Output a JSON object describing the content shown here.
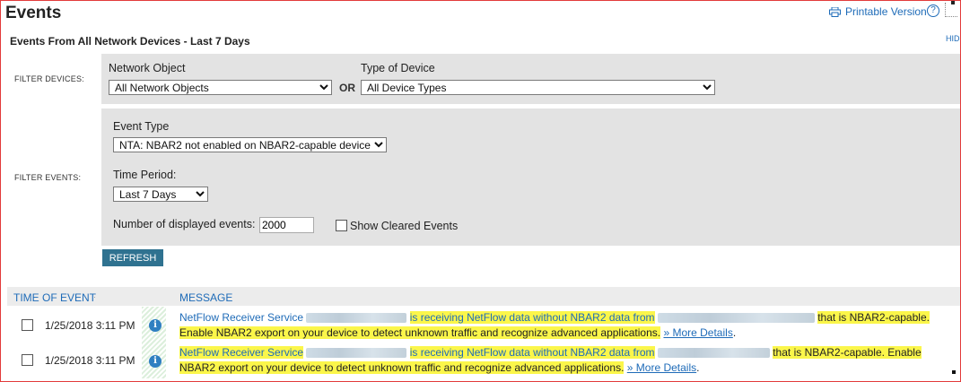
{
  "header": {
    "title": "Events",
    "printable_label": "Printable Version",
    "help_icon": "question-circle-icon",
    "hide_label": "HID",
    "subtitle": "Events From All Network Devices - Last 7 Days"
  },
  "filter_devices": {
    "label": "FILTER DEVICES:",
    "network_object_label": "Network Object",
    "network_object_value": "All Network Objects",
    "or_label": "OR",
    "device_type_label": "Type of Device",
    "device_type_value": "All Device Types"
  },
  "filter_events": {
    "label": "FILTER EVENTS:",
    "event_type_label": "Event Type",
    "event_type_value": "NTA: NBAR2 not enabled on NBAR2-capable device",
    "time_period_label": "Time Period:",
    "time_period_value": "Last 7 Days",
    "num_events_label": "Number of displayed events:",
    "num_events_value": "2000",
    "show_cleared_label": "Show Cleared Events",
    "refresh_label": "REFRESH"
  },
  "table": {
    "col_time": "TIME OF EVENT",
    "sort_glyph": "·",
    "col_message": "MESSAGE",
    "rows": [
      {
        "time": "1/25/2018 3:11 PM",
        "service": "NetFlow Receiver Service",
        "mid": "is receiving NetFlow data without NBAR2 data from",
        "tail": "that is NBAR2-capable.",
        "body": "Enable NBAR2 export on your device to detect unknown traffic and recognize advanced applications.",
        "more": "» More Details",
        "end": "."
      },
      {
        "time": "1/25/2018 3:11 PM",
        "service": "NetFlow Receiver Service",
        "mid": "is receiving NetFlow data without NBAR2 data from",
        "tail": "that is NBAR2-capable. Enable",
        "body": "NBAR2 export on your device to detect unknown traffic and recognize advanced applications.",
        "more": "» More Details",
        "end": "."
      }
    ]
  },
  "colors": {
    "accent": "#1e6bb8",
    "refresh_bg": "#2f7290",
    "highlight": "#fbf64a",
    "border": "#e23b3b"
  }
}
